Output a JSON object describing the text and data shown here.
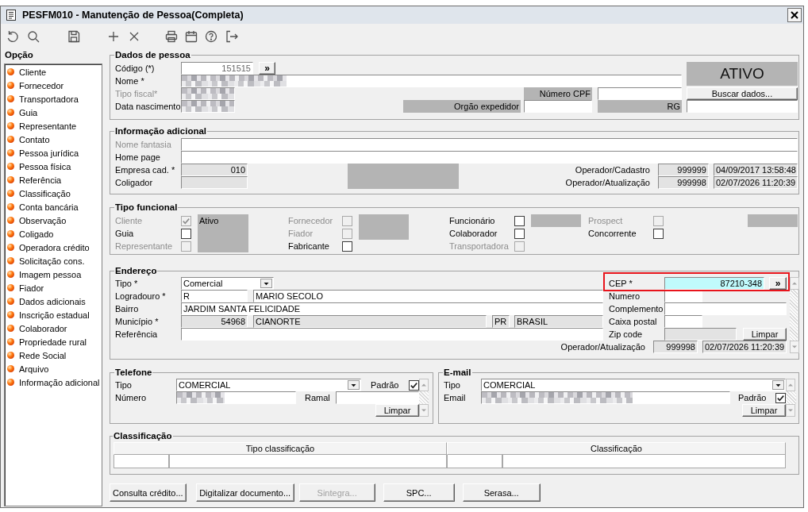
{
  "window": {
    "title": "PESFM010 - Manutenção de Pessoa(Completa)"
  },
  "sidebar": {
    "title": "Opção",
    "items": [
      {
        "label": "Cliente",
        "selected": false
      },
      {
        "label": "Fornecedor",
        "selected": false
      },
      {
        "label": "Transportadora",
        "selected": false
      },
      {
        "label": "Guia",
        "selected": false
      },
      {
        "label": "Representante",
        "selected": false
      },
      {
        "label": "Contato",
        "selected": false
      },
      {
        "label": "Pessoa jurídica",
        "selected": false
      },
      {
        "label": "Pessoa física",
        "selected": false
      },
      {
        "label": "Referência",
        "selected": false
      },
      {
        "label": "Classificação",
        "selected": false
      },
      {
        "label": "Conta bancária",
        "selected": false
      },
      {
        "label": "Observação",
        "selected": false
      },
      {
        "label": "Coligado",
        "selected": false
      },
      {
        "label": "Operadora crédito",
        "selected": false
      },
      {
        "label": "Solicitação cons.",
        "selected": false
      },
      {
        "label": "Imagem pessoa",
        "selected": false
      },
      {
        "label": "Fiador",
        "selected": false
      },
      {
        "label": "Dados adicionais",
        "selected": false
      },
      {
        "label": "Inscrição estadual",
        "selected": false
      },
      {
        "label": "Colaborador",
        "selected": false
      },
      {
        "label": "Propriedade rural",
        "selected": false
      },
      {
        "label": "Rede Social",
        "selected": false
      },
      {
        "label": "Arquivo",
        "selected": false
      },
      {
        "label": "Informação adicional",
        "selected": false
      }
    ]
  },
  "dados_pessoa": {
    "title": "Dados de pessoa",
    "codigo": {
      "label": "Código (*)",
      "disabled": false,
      "value": "151515",
      "lookup": "»"
    },
    "nome": {
      "label": "Nome *",
      "disabled": false,
      "blurred": true
    },
    "tipo_fiscal": {
      "label": "Tipo fiscal*",
      "disabled": true,
      "blurred": true
    },
    "data_nascimento": {
      "label": "Data nascimento",
      "disabled": false,
      "blurred": true
    },
    "status": "ATIVO",
    "cpf": {
      "label": "Número CPF"
    },
    "buscar_button": "Buscar dados...",
    "orgao_expedidor": {
      "label": "Orgão expedidor"
    },
    "rg": {
      "label": "RG"
    }
  },
  "informacao_adicional": {
    "title": "Informação adicional",
    "nome_fantasia": {
      "label": "Nome fantasia",
      "disabled": true
    },
    "home_page": {
      "label": "Home page",
      "disabled": false
    },
    "empresa_cad": {
      "label": "Empresa cad. *",
      "disabled": false,
      "value": "010"
    },
    "coligador": {
      "label": "Coligador",
      "disabled": false
    },
    "operador_cadastro": {
      "label": "Operador/Cadastro",
      "code": "999999",
      "timestamp": "04/09/2017 13:58:48"
    },
    "operador_atualizacao": {
      "label": "Operador/Atualização",
      "code": "999998",
      "timestamp": "02/07/2026 11:20:39"
    }
  },
  "tipo_funcional": {
    "title": "Tipo funcional",
    "columns": [
      {
        "items": [
          {
            "label": "Cliente",
            "checked": true,
            "disabled": true
          },
          {
            "label": "Guia",
            "checked": false,
            "disabled": false
          },
          {
            "label": "Representante",
            "checked": false,
            "disabled": true
          }
        ],
        "status": "Ativo"
      },
      {
        "items": [
          {
            "label": "Fornecedor",
            "checked": false,
            "disabled": true
          },
          {
            "label": "Fiador",
            "checked": false,
            "disabled": true
          },
          {
            "label": "Fabricante",
            "checked": false,
            "disabled": false
          }
        ]
      },
      {
        "items": [
          {
            "label": "Funcionário",
            "checked": false,
            "disabled": false
          },
          {
            "label": "Colaborador",
            "checked": false,
            "disabled": false
          },
          {
            "label": "Transportadora",
            "checked": false,
            "disabled": true
          }
        ]
      },
      {
        "items": [
          {
            "label": "Prospect",
            "checked": false,
            "disabled": true
          },
          {
            "label": "Concorrente",
            "checked": false,
            "disabled": false
          }
        ]
      }
    ]
  },
  "endereco": {
    "title": "Endereço",
    "tipo": {
      "label": "Tipo *",
      "value": "Comercial"
    },
    "logradouro": {
      "label": "Logradouro *",
      "type_value": "R",
      "value": "MARIO SECOLO"
    },
    "bairro": {
      "label": "Bairro",
      "value": "JARDIM SANTA FELICIDADE"
    },
    "municipio": {
      "label": "Município *",
      "code": "54968",
      "value": "CIANORTE",
      "uf": "PR",
      "country": "BRASIL"
    },
    "referencia": {
      "label": "Referência"
    },
    "cep": {
      "label": "CEP *",
      "value": "87210-348",
      "lookup": "»",
      "highlighted": true
    },
    "numero": {
      "label": "Numero"
    },
    "complemento": {
      "label": "Complemento"
    },
    "caixa_postal": {
      "label": "Caixa postal"
    },
    "zip_code": {
      "label": "Zip code"
    },
    "limpar_button": "Limpar",
    "operador_atualizacao": {
      "label": "Operador/Atualização",
      "code": "999998",
      "timestamp": "02/07/2026 11:20:39"
    }
  },
  "telefone": {
    "title": "Telefone",
    "tipo": {
      "label": "Tipo",
      "value": "COMERCIAL"
    },
    "padrao": {
      "label": "Padrão",
      "checked": true
    },
    "numero": {
      "label": "Número",
      "blurred": true
    },
    "ramal": {
      "label": "Ramal"
    },
    "limpar_button": "Limpar"
  },
  "email": {
    "title": "E-mail",
    "tipo": {
      "label": "Tipo",
      "value": "COMERCIAL"
    },
    "email": {
      "label": "Email",
      "blurred": true
    },
    "padrao": {
      "label": "Padrão",
      "checked": true
    },
    "limpar_button": "Limpar"
  },
  "classificacao": {
    "title": "Classificação",
    "columns": [
      "Tipo classificação",
      "Classificação"
    ]
  },
  "buttons": [
    {
      "label": "Consulta crédito...",
      "disabled": false
    },
    {
      "label": "Digitalizar documento...",
      "disabled": false
    },
    {
      "label": "Sintegra...",
      "disabled": true
    },
    {
      "label": "SPC...",
      "disabled": false
    },
    {
      "label": "Serasa...",
      "disabled": false
    }
  ]
}
